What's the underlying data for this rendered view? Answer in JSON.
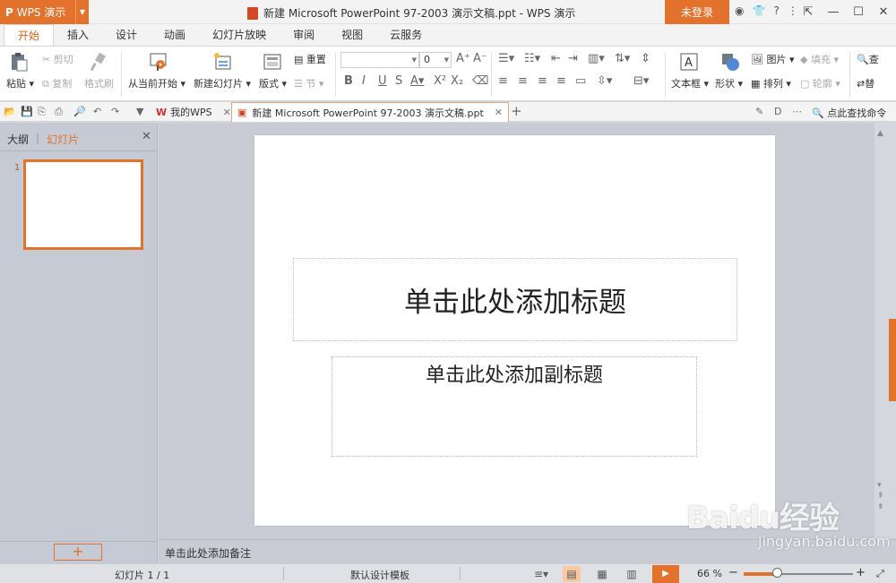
{
  "app": {
    "menu_button": "WPS 演示",
    "window_title": "新建 Microsoft PowerPoint 97-2003 演示文稿.ppt - WPS 演示",
    "login_button": "未登录",
    "accent_color": "#e2722c"
  },
  "menu_tabs": [
    "开始",
    "插入",
    "设计",
    "动画",
    "幻灯片放映",
    "审阅",
    "视图",
    "云服务"
  ],
  "ribbon": {
    "paste": "粘贴",
    "cut": "剪切",
    "copy": "复制",
    "format_painter": "格式刷",
    "start_from_current": "从当前开始",
    "new_slide": "新建幻灯片",
    "layout": "版式",
    "reset": "重置",
    "section": "节",
    "font_size": "0",
    "text_box": "文本框",
    "shape": "形状",
    "picture": "图片",
    "fill": "填充",
    "arrange": "排列",
    "outline": "轮廓",
    "find": "查",
    "replace": "替"
  },
  "quick_bar": {
    "my_wps_tab": "我的WPS",
    "document_tab": "新建 Microsoft PowerPoint 97-2003 演示文稿.ppt",
    "search_command": "点此查找命令"
  },
  "left_panel": {
    "outline_tab": "大纲",
    "slides_tab": "幻灯片",
    "slide_number": "1"
  },
  "slide": {
    "title_placeholder": "单击此处添加标题",
    "subtitle_placeholder": "单击此处添加副标题"
  },
  "notes": {
    "placeholder": "单击此处添加备注"
  },
  "status_bar": {
    "slide_info": "幻灯片 1 / 1",
    "template": "默认设计模板",
    "zoom": "66 %",
    "zoom_level": 0.3
  },
  "watermark": {
    "logo": "Baidu经验",
    "url": "jingyan.baidu.com"
  }
}
